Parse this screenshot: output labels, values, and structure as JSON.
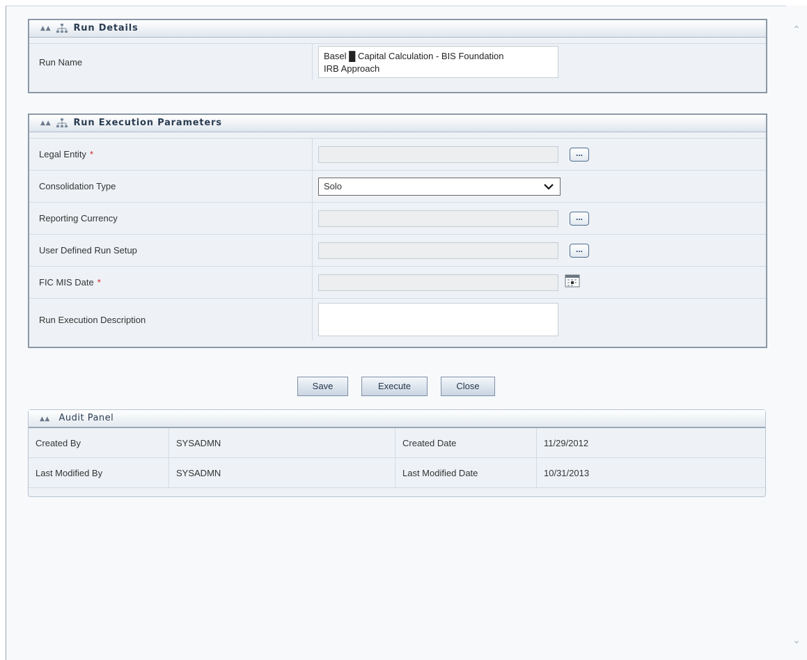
{
  "run_details": {
    "title": "Run Details",
    "run_name_label": "Run Name",
    "run_name_value_line1": "Basel █ Capital Calculation - BIS Foundation",
    "run_name_value_line2": "IRB Approach"
  },
  "run_execution": {
    "title": "Run Execution Parameters",
    "rows": [
      {
        "label": "Legal Entity",
        "required": "*",
        "value": "",
        "control": "lookup"
      },
      {
        "label": "Consolidation Type",
        "required": "",
        "value": "Solo",
        "control": "select"
      },
      {
        "label": "Reporting Currency",
        "required": "",
        "value": "",
        "control": "lookup"
      },
      {
        "label": "User Defined Run Setup",
        "required": "",
        "value": "",
        "control": "lookup"
      },
      {
        "label": "FIC MIS Date",
        "required": "*",
        "value": "",
        "control": "calendar"
      },
      {
        "label": "Run Execution Description",
        "required": "",
        "value": "",
        "control": "textarea"
      }
    ],
    "lookup_label": "..."
  },
  "actions": {
    "save": "Save",
    "execute": "Execute",
    "close": "Close"
  },
  "audit": {
    "title": "Audit Panel",
    "rows": [
      {
        "label1": "Created By",
        "value1": "SYSADMN",
        "label2": "Created Date",
        "value2": "11/29/2012"
      },
      {
        "label1": "Last Modified By",
        "value1": "SYSADMN",
        "label2": "Last Modified Date",
        "value2": "10/31/2013"
      }
    ]
  },
  "icons": {
    "collapse": "double-chevron-up-icon",
    "tree": "hierarchy-icon",
    "lookup": "ellipsis-button",
    "calendar": "calendar-icon",
    "dropdown": "chevron-down-icon"
  },
  "colors": {
    "panel_border": "#8c98a6",
    "header_text": "#2b3d52",
    "required": "#d02020",
    "button_border": "#7d91a7"
  }
}
